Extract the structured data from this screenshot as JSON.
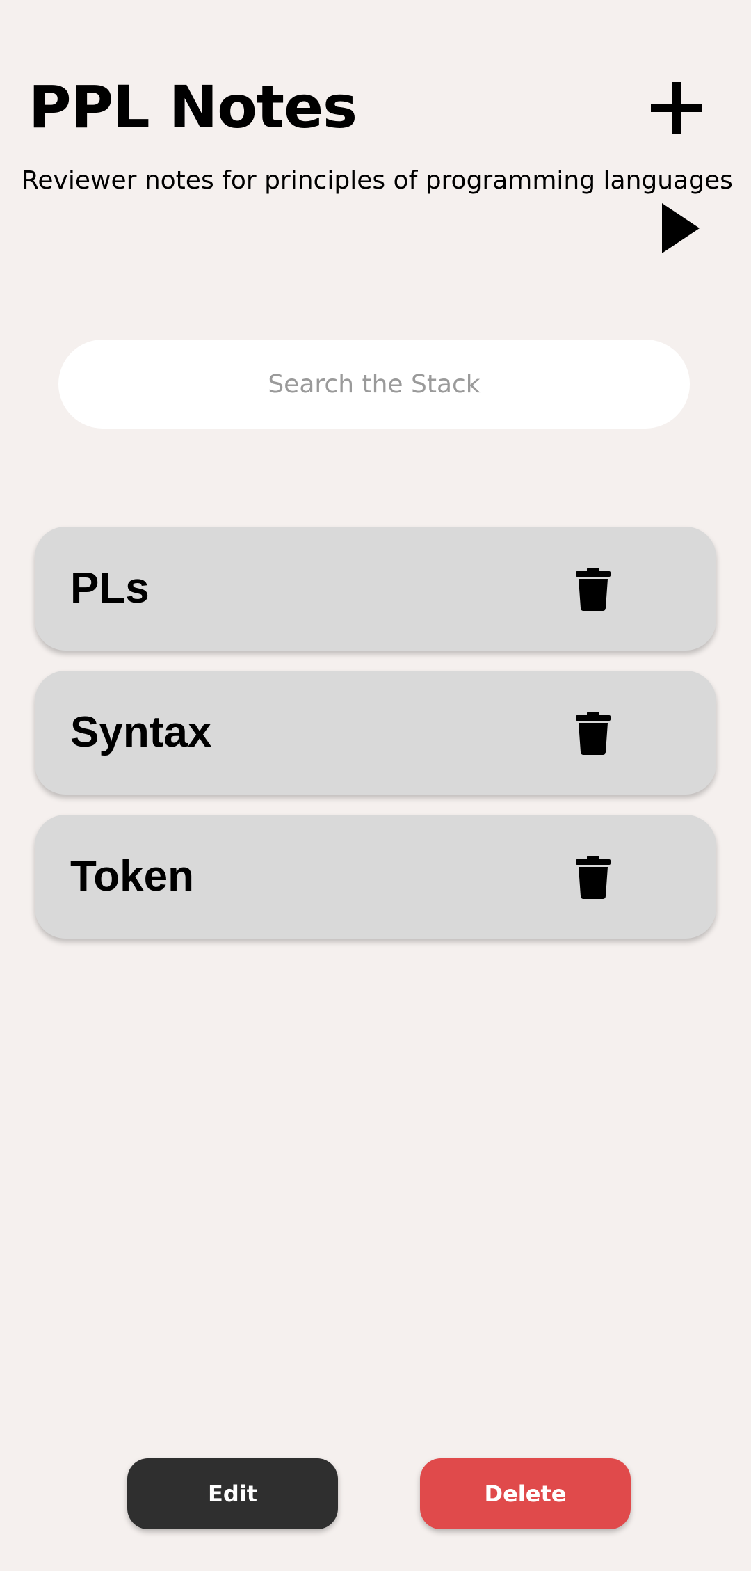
{
  "header": {
    "title": "PPL Notes",
    "subtitle": "Reviewer notes for principles of programming languages"
  },
  "icons": {
    "add": "plus-icon",
    "play": "play-icon",
    "delete_item": "trash-icon"
  },
  "search": {
    "placeholder": "Search the Stack",
    "value": ""
  },
  "notes": [
    {
      "label": "PLs"
    },
    {
      "label": "Syntax"
    },
    {
      "label": "Token"
    }
  ],
  "actions": {
    "edit_label": "Edit",
    "delete_label": "Delete"
  },
  "colors": {
    "background": "#f5f0ee",
    "card": "#d9d9d9",
    "edit_button": "#2f2f2f",
    "delete_button": "#e04a4b"
  }
}
